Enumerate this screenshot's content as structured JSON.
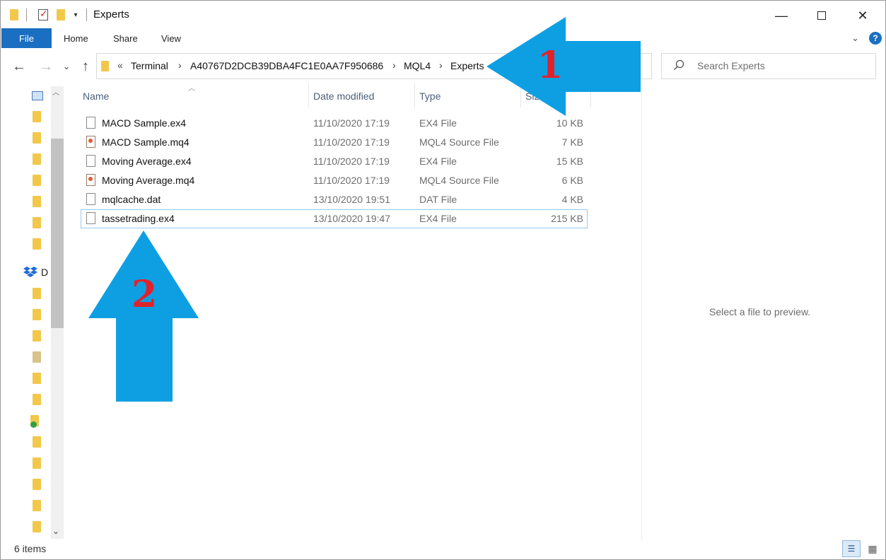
{
  "window": {
    "title": "Experts"
  },
  "ribbon": {
    "tabs": [
      "File",
      "Home",
      "Share",
      "View"
    ]
  },
  "address": {
    "overflow": "«",
    "crumbs": [
      "Terminal",
      "A40767D2DCB39DBA4FC1E0AA7F950686",
      "MQL4",
      "Experts"
    ]
  },
  "search": {
    "placeholder": "Search Experts"
  },
  "columns": {
    "name": "Name",
    "date": "Date modified",
    "type": "Type",
    "size": "Size"
  },
  "files": [
    {
      "name": "MACD Sample.ex4",
      "date": "11/10/2020 17:19",
      "type": "EX4 File",
      "size": "10 KB",
      "icon": "file-icon"
    },
    {
      "name": "MACD Sample.mq4",
      "date": "11/10/2020 17:19",
      "type": "MQL4 Source File",
      "size": "7 KB",
      "icon": "mq4-file-icon"
    },
    {
      "name": "Moving Average.ex4",
      "date": "11/10/2020 17:19",
      "type": "EX4 File",
      "size": "15 KB",
      "icon": "file-icon"
    },
    {
      "name": "Moving Average.mq4",
      "date": "11/10/2020 17:19",
      "type": "MQL4 Source File",
      "size": "6 KB",
      "icon": "mq4-file-icon"
    },
    {
      "name": "mqlcache.dat",
      "date": "13/10/2020 19:51",
      "type": "DAT File",
      "size": "4 KB",
      "icon": "file-icon"
    },
    {
      "name": "tassetrading.ex4",
      "date": "13/10/2020 19:47",
      "type": "EX4 File",
      "size": "215 KB",
      "icon": "file-icon",
      "selected": true
    }
  ],
  "preview": {
    "message": "Select a file to preview."
  },
  "status": {
    "items": "6 items"
  },
  "nav": {
    "dropbox_label": "D"
  },
  "annotations": {
    "arrow1": "1",
    "arrow2": "2",
    "color": "#0e9fe3",
    "number_color": "#e1222a"
  }
}
